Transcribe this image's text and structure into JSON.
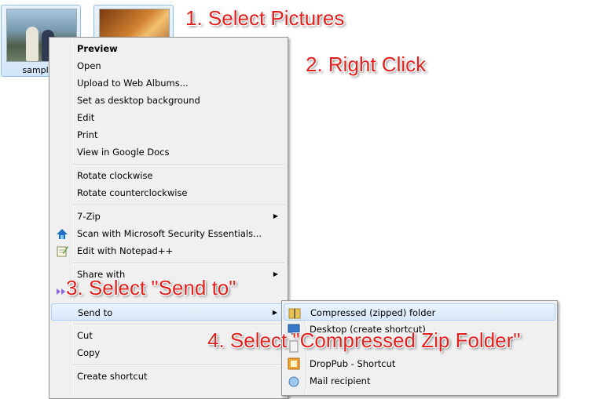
{
  "thumbnails": [
    {
      "label": "sample1"
    },
    {
      "label": ""
    }
  ],
  "callouts": {
    "step1": "1. Select Pictures",
    "step2": "2. Right Click",
    "step3": "3. Select \"Send to\"",
    "step4": "4. Select \"Compressed Zip Folder\""
  },
  "context_menu": {
    "items": [
      {
        "label": "Preview"
      },
      {
        "label": "Open"
      },
      {
        "label": "Upload to Web Albums..."
      },
      {
        "label": "Set as desktop background"
      },
      {
        "label": "Edit"
      },
      {
        "label": "Print"
      },
      {
        "label": "View in Google Docs"
      },
      {
        "label": "Rotate clockwise"
      },
      {
        "label": "Rotate counterclockwise"
      },
      {
        "label": "7-Zip"
      },
      {
        "label": "Scan with Microsoft Security Essentials..."
      },
      {
        "label": "Edit with Notepad++"
      },
      {
        "label": "Share with"
      },
      {
        "label": "Send to"
      },
      {
        "label": "Cut"
      },
      {
        "label": "Copy"
      },
      {
        "label": "Create shortcut"
      }
    ]
  },
  "send_to_submenu": {
    "items": [
      {
        "label": "Compressed (zipped) folder"
      },
      {
        "label": "Desktop (create shortcut)"
      },
      {
        "label": "DropPub - Shortcut"
      },
      {
        "label": "Mail recipient"
      }
    ]
  },
  "colors": {
    "callout": "#e0211d",
    "menu_bg": "#f0f0f0",
    "hover_border": "#aecff7"
  }
}
